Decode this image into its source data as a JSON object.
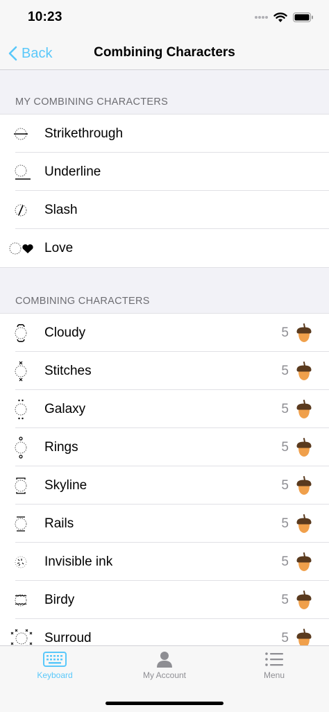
{
  "status": {
    "time": "10:23"
  },
  "nav": {
    "back_label": "Back",
    "title": "Combining Characters"
  },
  "sections": {
    "mine_header": "MY COMBINING CHARACTERS",
    "all_header": "COMBINING CHARACTERS"
  },
  "my_items": [
    {
      "label": "Strikethrough",
      "icon": "strikethrough-icon"
    },
    {
      "label": "Underline",
      "icon": "underline-icon"
    },
    {
      "label": "Slash",
      "icon": "slash-icon"
    },
    {
      "label": "Love",
      "icon": "love-icon"
    }
  ],
  "items": [
    {
      "label": "Cloudy",
      "price": "5",
      "icon": "cloudy-icon"
    },
    {
      "label": "Stitches",
      "price": "5",
      "icon": "stitches-icon"
    },
    {
      "label": "Galaxy",
      "price": "5",
      "icon": "galaxy-icon"
    },
    {
      "label": "Rings",
      "price": "5",
      "icon": "rings-icon"
    },
    {
      "label": "Skyline",
      "price": "5",
      "icon": "skyline-icon"
    },
    {
      "label": "Rails",
      "price": "5",
      "icon": "rails-icon"
    },
    {
      "label": "Invisible ink",
      "price": "5",
      "icon": "invisible-ink-icon"
    },
    {
      "label": "Birdy",
      "price": "5",
      "icon": "birdy-icon"
    },
    {
      "label": "Surroud",
      "price": "5",
      "icon": "surround-icon"
    }
  ],
  "tabs": [
    {
      "label": "Keyboard",
      "active": true
    },
    {
      "label": "My Account",
      "active": false
    },
    {
      "label": "Menu",
      "active": false
    }
  ],
  "colors": {
    "accent": "#5ac8fa",
    "acorn": "#f0a04b",
    "acorn_cap": "#5a3a1e"
  }
}
